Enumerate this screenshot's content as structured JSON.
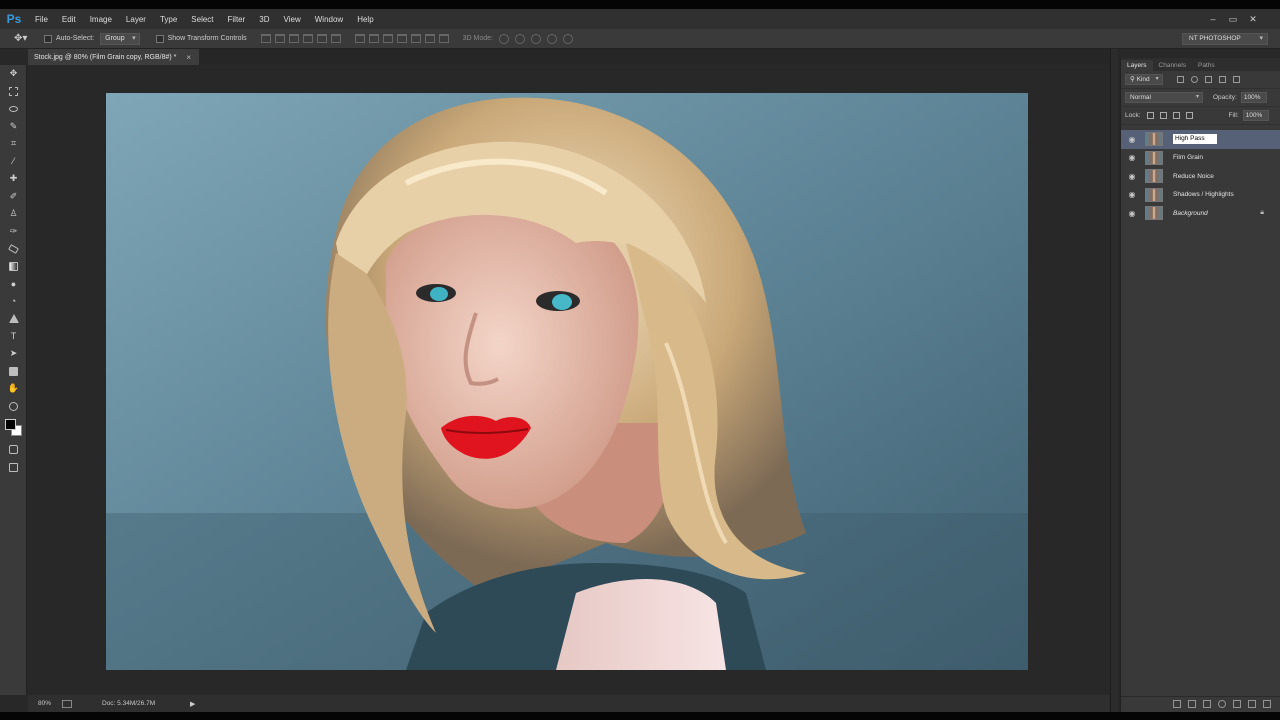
{
  "app": {
    "logo": "Ps",
    "window_controls": [
      "–",
      "▭",
      "✕"
    ]
  },
  "menu": [
    "File",
    "Edit",
    "Image",
    "Layer",
    "Type",
    "Select",
    "Filter",
    "3D",
    "View",
    "Window",
    "Help"
  ],
  "options": {
    "tool_icon": "move-tool-icon",
    "auto_select_label": "Auto-Select:",
    "auto_select_value": "Group",
    "transform_label": "Show Transform Controls",
    "mode_3d_label": "3D Mode:",
    "workspace": "NT PHOTOSHOP"
  },
  "document": {
    "tab_title": "Stock.jpg @ 80% (Film Grain copy, RGB/8#) *",
    "close": "×"
  },
  "status": {
    "zoom": "80%",
    "doc_size": "Doc: 5.34M/26.7M",
    "arrow": "▶"
  },
  "tools": [
    "move-tool",
    "marquee-tool",
    "lasso-tool",
    "quick-selection-tool",
    "crop-tool",
    "eyedropper-tool",
    "spot-healing-tool",
    "brush-tool",
    "clone-stamp-tool",
    "history-brush-tool",
    "eraser-tool",
    "gradient-tool",
    "blur-tool",
    "dodge-tool",
    "pen-tool",
    "type-tool",
    "path-selection-tool",
    "rectangle-tool",
    "hand-tool",
    "zoom-tool"
  ],
  "colors": {
    "foreground": "#000000",
    "background": "#ffffff",
    "selected_layer": "#566178"
  },
  "layers_panel": {
    "tabs": [
      "Layers",
      "Channels",
      "Paths"
    ],
    "kind_label": "Kind",
    "blend_mode": "Normal",
    "opacity_label": "Opacity:",
    "opacity_value": "100%",
    "lock_label": "Lock:",
    "fill_label": "Fill:",
    "fill_value": "100%",
    "layers": [
      {
        "name": "High Pass",
        "selected": true,
        "editing": true
      },
      {
        "name": "Film Grain"
      },
      {
        "name": "Reduce Noice"
      },
      {
        "name": "Shadows / Highlights"
      },
      {
        "name": "Background",
        "locked": true
      }
    ]
  }
}
